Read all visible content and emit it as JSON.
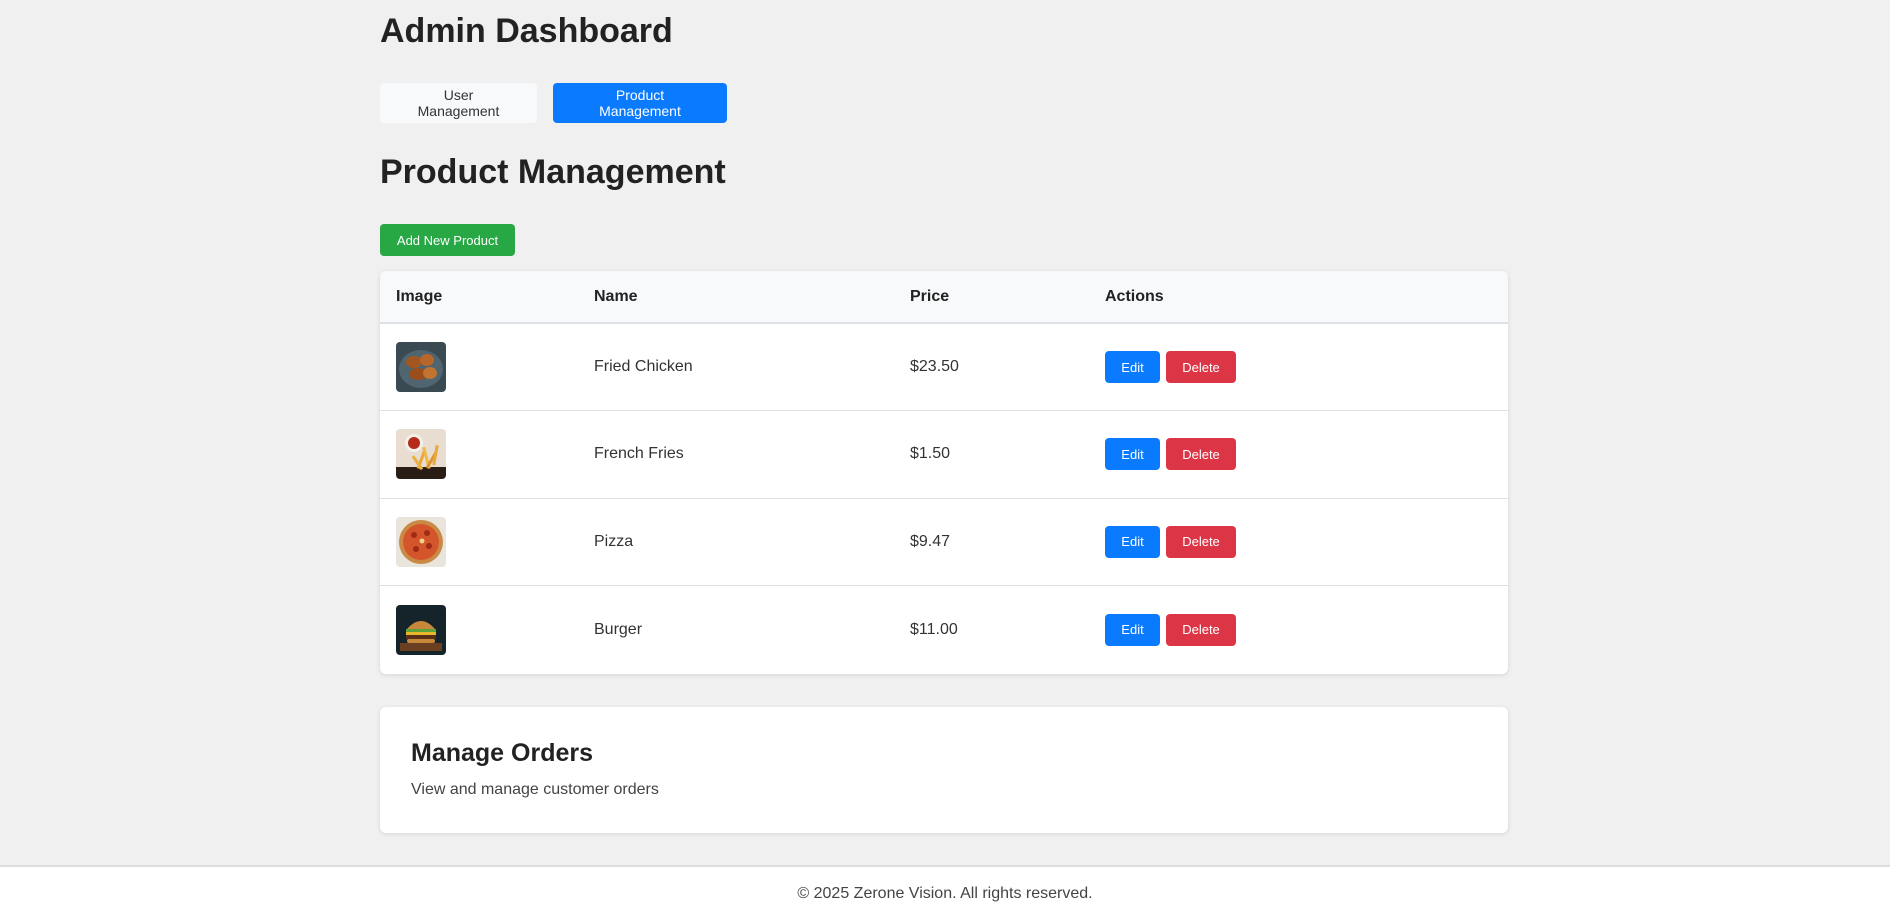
{
  "header": {
    "title": "Admin Dashboard"
  },
  "tabs": [
    {
      "label": "User Management",
      "active": false
    },
    {
      "label": "Product Management",
      "active": true
    }
  ],
  "products_section": {
    "title": "Product Management",
    "add_button": "Add New Product",
    "columns": [
      "Image",
      "Name",
      "Price",
      "Actions"
    ],
    "rows": [
      {
        "image": "fried-chicken-image",
        "name": "Fried Chicken",
        "price": "$23.50",
        "edit": "Edit",
        "delete": "Delete"
      },
      {
        "image": "french-fries-image",
        "name": "French Fries",
        "price": "$1.50",
        "edit": "Edit",
        "delete": "Delete"
      },
      {
        "image": "pizza-image",
        "name": "Pizza",
        "price": "$9.47",
        "edit": "Edit",
        "delete": "Delete"
      },
      {
        "image": "burger-image",
        "name": "Burger",
        "price": "$11.00",
        "edit": "Edit",
        "delete": "Delete"
      }
    ]
  },
  "orders_card": {
    "title": "Manage Orders",
    "description": "View and manage customer orders"
  },
  "footer": {
    "text": "© 2025 Zerone Vision. All rights reserved."
  },
  "colors": {
    "primary": "#0a7bff",
    "success": "#28a745",
    "danger": "#dc3545",
    "background": "#f0f0f0"
  }
}
